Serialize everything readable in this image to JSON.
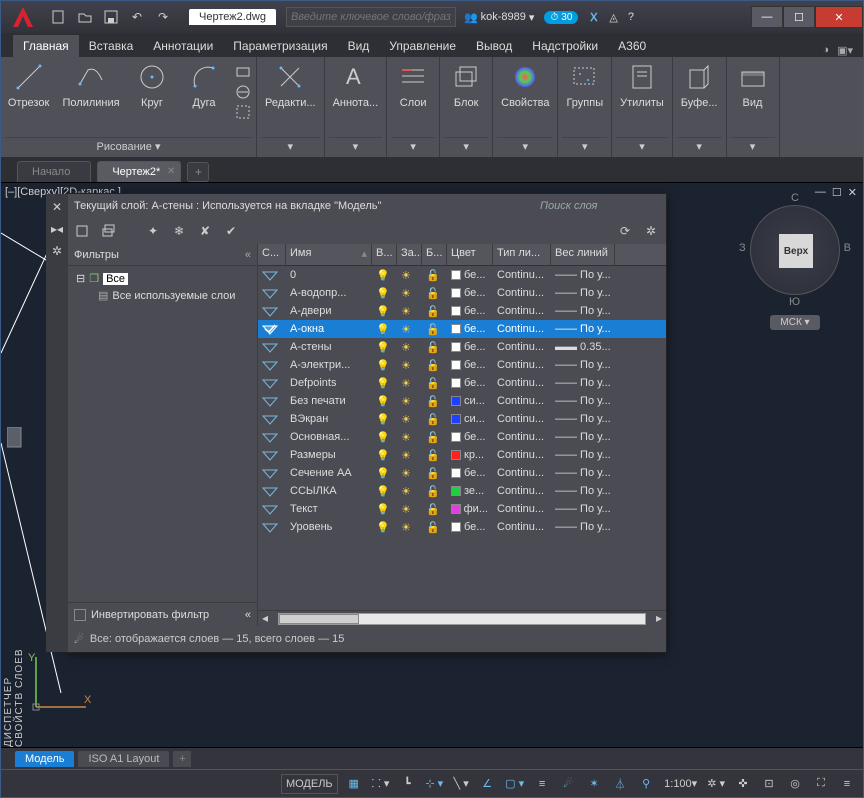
{
  "window": {
    "title": "Чертеж2.dwg",
    "search_placeholder": "Введите ключевое слово/фразу",
    "user": "kok-8989",
    "timer": "30"
  },
  "ribbon_tabs": [
    "Главная",
    "Вставка",
    "Аннотации",
    "Параметризация",
    "Вид",
    "Управление",
    "Вывод",
    "Надстройки",
    "A360"
  ],
  "ribbon": {
    "draw": {
      "name": "Рисование",
      "items": [
        "Отрезок",
        "Полилиния",
        "Круг",
        "Дуга"
      ]
    },
    "panels": [
      {
        "label": "Редакти...",
        "name": ""
      },
      {
        "label": "Аннота...",
        "name": ""
      },
      {
        "label": "Слои",
        "name": ""
      },
      {
        "label": "Блок",
        "name": ""
      },
      {
        "label": "Свойства",
        "name": ""
      },
      {
        "label": "Группы",
        "name": ""
      },
      {
        "label": "Утилиты",
        "name": ""
      },
      {
        "label": "Буфе...",
        "name": ""
      },
      {
        "label": "Вид",
        "name": ""
      }
    ]
  },
  "doc_tabs": {
    "start": "Начало",
    "active": "Чертеж2*"
  },
  "viewport": {
    "label": "[–][Сверху][2D-каркас ]",
    "viewcube": {
      "face": "Верх",
      "n": "С",
      "s": "Ю",
      "w": "З",
      "e": "В"
    },
    "wcs": "МСК",
    "sidebar": "ДИСПЕТЧЕР СВОЙСТВ СЛОЕВ"
  },
  "layer_palette": {
    "title": "Текущий слой: А-стены : Используется на вкладке \"Модель\"",
    "search_placeholder": "Поиск слоя",
    "filters_label": "Фильтры",
    "filter_all": "Все",
    "filter_used": "Все используемые слои",
    "invert": "Инвертировать фильтр",
    "footer": "Все: отображается слоев — 15, всего слоев — 15",
    "columns": [
      "С...",
      "Имя",
      "В...",
      "За...",
      "Б...",
      "Цвет",
      "Тип ли...",
      "Вес линий"
    ],
    "selected": 3,
    "rows": [
      {
        "name": "0",
        "color": "#ffffff",
        "clabel": "бе...",
        "lt": "Continu...",
        "lw": "—— По у..."
      },
      {
        "name": "А-водопр...",
        "color": "#ffffff",
        "clabel": "бе...",
        "lt": "Continu...",
        "lw": "—— По у..."
      },
      {
        "name": "А-двери",
        "color": "#ffffff",
        "clabel": "бе...",
        "lt": "Continu...",
        "lw": "—— По у..."
      },
      {
        "name": "А-окна",
        "color": "#ffffff",
        "clabel": "бе...",
        "lt": "Continu...",
        "lw": "—— По у..."
      },
      {
        "name": "А-стены",
        "color": "#ffffff",
        "clabel": "бе...",
        "lt": "Continu...",
        "lw": "▬▬ 0.35..."
      },
      {
        "name": "А-электри...",
        "color": "#ffffff",
        "clabel": "бе...",
        "lt": "Continu...",
        "lw": "—— По у..."
      },
      {
        "name": "Defpoints",
        "color": "#ffffff",
        "clabel": "бе...",
        "lt": "Continu...",
        "lw": "—— По у..."
      },
      {
        "name": "Без печати",
        "color": "#2040ff",
        "clabel": "си...",
        "lt": "Continu...",
        "lw": "—— По у..."
      },
      {
        "name": "ВЭкран",
        "color": "#2040ff",
        "clabel": "си...",
        "lt": "Continu...",
        "lw": "—— По у..."
      },
      {
        "name": "Основная...",
        "color": "#ffffff",
        "clabel": "бе...",
        "lt": "Continu...",
        "lw": "—— По у..."
      },
      {
        "name": "Размеры",
        "color": "#ff2020",
        "clabel": "кр...",
        "lt": "Continu...",
        "lw": "—— По у..."
      },
      {
        "name": "Сечение АА",
        "color": "#ffffff",
        "clabel": "бе...",
        "lt": "Continu...",
        "lw": "—— По у..."
      },
      {
        "name": "ССЫЛКА",
        "color": "#20d040",
        "clabel": "зе...",
        "lt": "Continu...",
        "lw": "—— По у..."
      },
      {
        "name": "Текст",
        "color": "#e040e0",
        "clabel": "фи...",
        "lt": "Continu...",
        "lw": "—— По у..."
      },
      {
        "name": "Уровень",
        "color": "#ffffff",
        "clabel": "бе...",
        "lt": "Continu...",
        "lw": "—— По у..."
      }
    ]
  },
  "model_tabs": [
    "Модель",
    "ISO A1 Layout"
  ],
  "statusbar": {
    "model": "МОДЕЛЬ",
    "scale": "1:100"
  }
}
